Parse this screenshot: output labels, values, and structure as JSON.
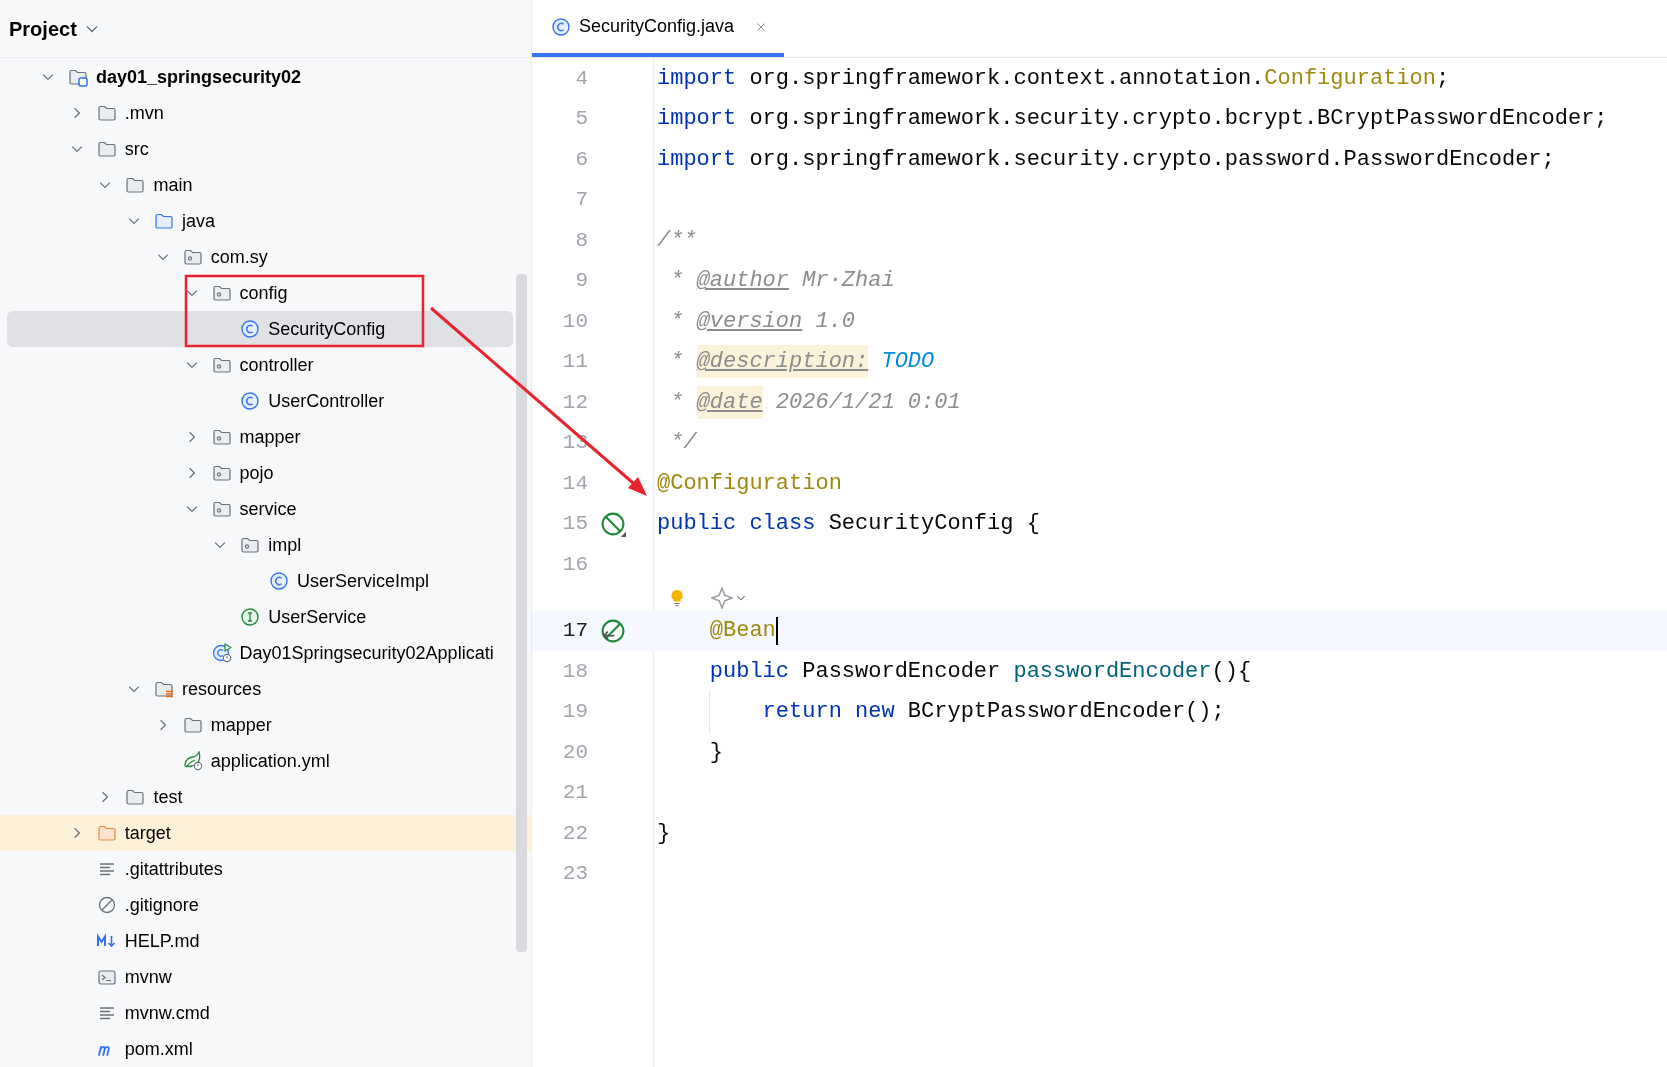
{
  "project": {
    "title": "Project",
    "tree": [
      {
        "label": "day01_springsecurity02",
        "kind": "module",
        "expanded": true,
        "selected": false,
        "children": [
          {
            "label": ".mvn",
            "kind": "folder",
            "expanded": false,
            "selected": false
          },
          {
            "label": "src",
            "kind": "folder",
            "expanded": true,
            "selected": false,
            "children": [
              {
                "label": "main",
                "kind": "folder",
                "expanded": true,
                "selected": false,
                "children": [
                  {
                    "label": "java",
                    "kind": "source-root",
                    "expanded": true,
                    "selected": false,
                    "children": [
                      {
                        "label": "com.sy",
                        "kind": "package",
                        "expanded": true,
                        "selected": false,
                        "children": [
                          {
                            "label": "config",
                            "kind": "package",
                            "expanded": true,
                            "selected": false,
                            "children": [
                              {
                                "label": "SecurityConfig",
                                "kind": "class",
                                "selected": true
                              }
                            ]
                          },
                          {
                            "label": "controller",
                            "kind": "package",
                            "expanded": true,
                            "selected": false,
                            "children": [
                              {
                                "label": "UserController",
                                "kind": "class",
                                "selected": false
                              }
                            ]
                          },
                          {
                            "label": "mapper",
                            "kind": "package",
                            "expanded": false,
                            "selected": false
                          },
                          {
                            "label": "pojo",
                            "kind": "package",
                            "expanded": false,
                            "selected": false
                          },
                          {
                            "label": "service",
                            "kind": "package",
                            "expanded": true,
                            "selected": false,
                            "children": [
                              {
                                "label": "impl",
                                "kind": "package",
                                "expanded": true,
                                "selected": false,
                                "children": [
                                  {
                                    "label": "UserServiceImpl",
                                    "kind": "class",
                                    "selected": false
                                  }
                                ]
                              },
                              {
                                "label": "UserService",
                                "kind": "interface",
                                "selected": false
                              }
                            ]
                          },
                          {
                            "label": "Day01Springsecurity02Applicati",
                            "kind": "app-class",
                            "selected": false
                          }
                        ]
                      }
                    ]
                  },
                  {
                    "label": "resources",
                    "kind": "resources-root",
                    "expanded": true,
                    "selected": false,
                    "children": [
                      {
                        "label": "mapper",
                        "kind": "folder",
                        "expanded": false,
                        "selected": false
                      },
                      {
                        "label": "application.yml",
                        "kind": "yaml",
                        "selected": false
                      }
                    ]
                  }
                ]
              },
              {
                "label": "test",
                "kind": "folder",
                "expanded": false,
                "selected": false
              }
            ]
          },
          {
            "label": "target",
            "kind": "excluded",
            "expanded": false,
            "selected": false
          },
          {
            "label": ".gitattributes",
            "kind": "text",
            "selected": false
          },
          {
            "label": ".gitignore",
            "kind": "gitignore",
            "selected": false
          },
          {
            "label": "HELP.md",
            "kind": "markdown",
            "selected": false
          },
          {
            "label": "mvnw",
            "kind": "script",
            "selected": false
          },
          {
            "label": "mvnw.cmd",
            "kind": "text",
            "selected": false
          },
          {
            "label": "pom.xml",
            "kind": "maven",
            "selected": false
          }
        ]
      }
    ]
  },
  "editor": {
    "tabs": [
      {
        "label": "SecurityConfig.java",
        "selected": true
      }
    ],
    "lines": [
      {
        "kind": "code",
        "number": "4",
        "current": false,
        "tokens": [
          {
            "text": "import",
            "kind": "keyword"
          },
          {
            "text": " org.springframework.context.annotation.",
            "kind": "plain"
          },
          {
            "text": "Configuration",
            "kind": "annotation"
          },
          {
            "text": ";",
            "kind": "plain"
          }
        ]
      },
      {
        "kind": "code",
        "number": "5",
        "current": false,
        "tokens": [
          {
            "text": "import",
            "kind": "keyword"
          },
          {
            "text": " org.springframework.security.crypto.bcrypt.BCryptPasswordEncoder;",
            "kind": "plain"
          }
        ]
      },
      {
        "kind": "code",
        "number": "6",
        "current": false,
        "tokens": [
          {
            "text": "import",
            "kind": "keyword"
          },
          {
            "text": " org.springframework.security.crypto.password.PasswordEncoder;",
            "kind": "plain"
          }
        ]
      },
      {
        "kind": "code",
        "number": "7",
        "current": false
      },
      {
        "kind": "code",
        "number": "8",
        "current": false,
        "tokens": [
          {
            "text": "/**",
            "kind": "comment"
          }
        ]
      },
      {
        "kind": "code",
        "number": "9",
        "current": false,
        "tokens": [
          {
            "text": " * ",
            "kind": "comment"
          },
          {
            "text": "@author",
            "kind": "doc-tag"
          },
          {
            "text": " Mr·Zhai",
            "kind": "comment"
          }
        ]
      },
      {
        "kind": "code",
        "number": "10",
        "current": false,
        "tokens": [
          {
            "text": " * ",
            "kind": "comment"
          },
          {
            "text": "@version",
            "kind": "doc-tag"
          },
          {
            "text": " 1.0",
            "kind": "comment"
          }
        ]
      },
      {
        "kind": "code",
        "number": "11",
        "current": false,
        "tokens": [
          {
            "text": " * ",
            "kind": "comment"
          },
          {
            "text": "@description:",
            "kind": "doc-tag-flagged"
          },
          {
            "text": " TODO",
            "kind": "todo"
          }
        ]
      },
      {
        "kind": "code",
        "number": "12",
        "current": false,
        "tokens": [
          {
            "text": " * ",
            "kind": "comment"
          },
          {
            "text": "@date",
            "kind": "doc-tag-flagged"
          },
          {
            "text": " 2026/1/21 0:01",
            "kind": "comment"
          }
        ]
      },
      {
        "kind": "code",
        "number": "13",
        "current": false,
        "tokens": [
          {
            "text": " */",
            "kind": "comment"
          }
        ]
      },
      {
        "kind": "code",
        "number": "14",
        "current": false,
        "tokens": [
          {
            "text": "@Configuration",
            "kind": "annotation"
          }
        ]
      },
      {
        "kind": "code",
        "number": "15",
        "current": false,
        "gutter_icon": {
          "kind": "bean-class"
        },
        "tokens": [
          {
            "text": "public",
            "kind": "keyword"
          },
          {
            "text": " class",
            "kind": "keyword"
          },
          {
            "text": " SecurityConfig {",
            "kind": "plain"
          }
        ]
      },
      {
        "kind": "code",
        "number": "16",
        "current": false
      },
      {
        "kind": "hint"
      },
      {
        "kind": "code",
        "number": "17",
        "current": true,
        "caret": true,
        "gutter_icon": {
          "kind": "bean-method"
        },
        "tokens": [
          {
            "text": "    @Bean",
            "kind": "annotation"
          }
        ]
      },
      {
        "kind": "code",
        "number": "18",
        "current": false,
        "tokens": [
          {
            "text": "    public",
            "kind": "keyword"
          },
          {
            "text": " PasswordEncoder ",
            "kind": "plain"
          },
          {
            "text": "passwordEncoder",
            "kind": "method"
          },
          {
            "text": "(){",
            "kind": "plain"
          }
        ]
      },
      {
        "kind": "code",
        "number": "19",
        "current": false,
        "indent_guide": true,
        "tokens": [
          {
            "text": "        return",
            "kind": "keyword"
          },
          {
            "text": " new",
            "kind": "keyword"
          },
          {
            "text": " BCryptPasswordEncoder();",
            "kind": "plain"
          }
        ]
      },
      {
        "kind": "code",
        "number": "20",
        "current": false,
        "tokens": [
          {
            "text": "    }",
            "kind": "plain"
          }
        ]
      },
      {
        "kind": "code",
        "number": "21",
        "current": false
      },
      {
        "kind": "code",
        "number": "22",
        "current": false,
        "tokens": [
          {
            "text": "}",
            "kind": "plain"
          }
        ]
      },
      {
        "kind": "code",
        "number": "23",
        "current": false
      }
    ]
  }
}
